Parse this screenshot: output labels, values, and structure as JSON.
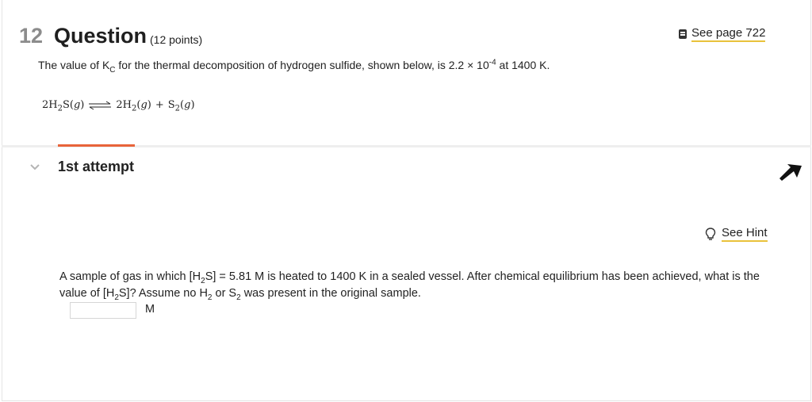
{
  "question": {
    "number": "12",
    "title": "Question",
    "points": "(12 points)",
    "see_page": "See page 722",
    "prompt": {
      "part1": "The value of K",
      "kc_sub": "C",
      "part2": " for the thermal decomposition of hydrogen sulfide, shown below, is 2.2 × 10",
      "exp": "-4",
      "part3": " at 1400 K."
    },
    "equation": {
      "lhs": "2H",
      "lhs_sub": "2",
      "lhs_rest": "S(",
      "g": "g",
      "close": ")",
      "rhs1": "2H",
      "rhs1_sub": "2",
      "rhs1_rest": "(",
      "plus": "+",
      "rhs2": "S",
      "rhs2_sub": "2",
      "rhs2_rest": "("
    }
  },
  "attempt": {
    "label": "1st attempt",
    "see_hint": "See Hint",
    "text": {
      "a": "A sample of gas in which [H",
      "a_sub": "2",
      "b": "S] = 5.81 M is heated to 1400 K in a sealed vessel. After chemical equilibrium has been achieved, what is the value of [H",
      "b_sub": "2",
      "c": "S]? Assume no H",
      "c_sub": "2",
      "d": " or S",
      "d_sub": "2",
      "e": " was present in the original sample."
    },
    "answer_value": "",
    "unit": "M"
  },
  "colors": {
    "accent": "#e8643a",
    "underline": "#e9c23b"
  },
  "icons": [
    "book-icon",
    "chevron-down-icon",
    "pointer-arrow-icon",
    "lightbulb-icon"
  ]
}
